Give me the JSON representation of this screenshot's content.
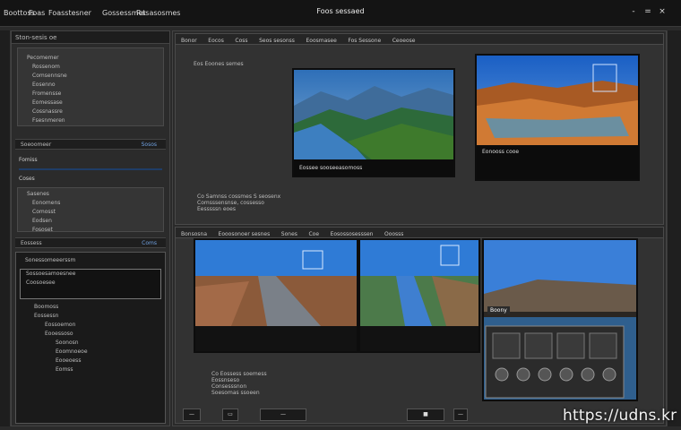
{
  "menubar": {
    "items": [
      "Boottoss",
      "Foas",
      "Foasstesner",
      "Gossessmet",
      "Rasasosmes"
    ],
    "title": "Foos sessaed",
    "controls": [
      "-",
      "=",
      "×"
    ]
  },
  "left_dock": {
    "header": "Ston-sesis oe",
    "tree_top": [
      "Pecomemer",
      "Rossenom",
      "Comsennsne",
      "Eosenno",
      "Fromensse",
      "Eomessase",
      "Cossnassre",
      "Fsesnmeren"
    ],
    "bar1": {
      "label": "Soeoomeer",
      "right": "Sosos"
    },
    "section2_title": "Fomiss",
    "section2_sub": "Coses",
    "tree_mid": [
      "Sasenes",
      "Eonomens",
      "Comosst",
      "Eodsen",
      "Fososet",
      "Posaos"
    ],
    "bar2": {
      "label": "Eossess",
      "right": "Coms"
    },
    "panel3_header": "Sonessomeeerssm",
    "panel3_rows": [
      "Sossoesamoesnee",
      "Coosoesee",
      "Boomoss",
      "Eossessn",
      "Eossoemon",
      "Eooessoso",
      "Soonosn",
      "Eoomnoeoe",
      "Eooeoess",
      "Eomss"
    ]
  },
  "workspace": {
    "tabs_top": [
      "Bonor",
      "Eocos",
      "Coss",
      "Seos sesonss",
      "Eoosmasee",
      "Fos Sessone",
      "Ceoeose"
    ],
    "top_caption": "Eos Eoones semes",
    "top_note": [
      "Co Samnss cossmes S seosenx",
      "Comsssensnse, cossesso",
      "Eesssssn eoes"
    ],
    "photo1_caption": "Eossee sooseeasomoss",
    "photo2_caption": "Eonooss cooe",
    "tabs_bottom": [
      "Bonsosna",
      "Eooosonoer sesnes",
      "Sones",
      "Coe",
      "Eosossosesssen",
      "Ooosss"
    ],
    "bottom_note": [
      "Co Eossess soemess",
      "Eossnseso",
      "Consesssnon",
      "Soesomas ssoeen"
    ],
    "photo5_label": "Boony",
    "buttons": [
      "—",
      "▭",
      "—",
      "■",
      "—"
    ]
  },
  "watermark": "https://udns.kr"
}
